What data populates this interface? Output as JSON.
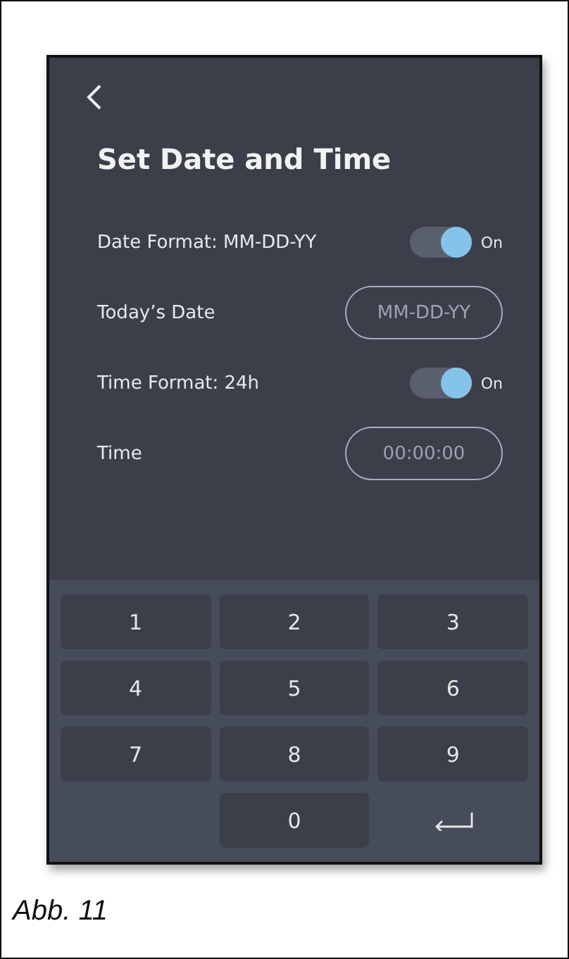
{
  "screen": {
    "title": "Set Date and Time",
    "rows": [
      {
        "kind": "toggle",
        "label": "Date Format: MM-DD-YY",
        "on": true,
        "state_label": "On"
      },
      {
        "kind": "field",
        "label": "Today’s Date",
        "placeholder": "MM-DD-YY"
      },
      {
        "kind": "toggle",
        "label": "Time Format: 24h",
        "on": true,
        "state_label": "On"
      },
      {
        "kind": "field",
        "label": "Time",
        "placeholder": "00:00:00"
      }
    ],
    "keypad": [
      {
        "kind": "digit",
        "label": "1"
      },
      {
        "kind": "digit",
        "label": "2"
      },
      {
        "kind": "digit",
        "label": "3"
      },
      {
        "kind": "digit",
        "label": "4"
      },
      {
        "kind": "digit",
        "label": "5"
      },
      {
        "kind": "digit",
        "label": "6"
      },
      {
        "kind": "digit",
        "label": "7"
      },
      {
        "kind": "digit",
        "label": "8"
      },
      {
        "kind": "digit",
        "label": "9"
      },
      {
        "kind": "blank"
      },
      {
        "kind": "digit",
        "label": "0"
      },
      {
        "kind": "enter"
      }
    ]
  },
  "caption": "Abb. 11"
}
